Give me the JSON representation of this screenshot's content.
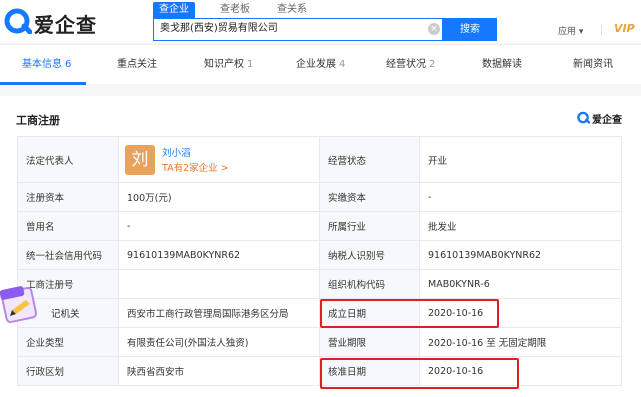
{
  "header": {
    "logo_text": "爱企查",
    "tabs": [
      "查企业",
      "查老板",
      "查关系"
    ],
    "search_value": "奥戈那(西安)贸易有限公司",
    "clear_symbol": "×",
    "search_button": "搜索",
    "apps_label": "应用 ▾",
    "vip_label": "VIP"
  },
  "nav": [
    {
      "label": "基本信息",
      "count": "6"
    },
    {
      "label": "重点关注",
      "count": ""
    },
    {
      "label": "知识产权",
      "count": "1"
    },
    {
      "label": "企业发展",
      "count": "4"
    },
    {
      "label": "经营状况",
      "count": "2"
    },
    {
      "label": "数据解读",
      "count": ""
    },
    {
      "label": "新闻资讯",
      "count": ""
    }
  ],
  "section": {
    "title": "工商注册",
    "brand": "爱企查"
  },
  "table": {
    "legal_rep_label": "法定代表人",
    "legal_rep_avatar": "刘",
    "legal_rep_name": "刘小滔",
    "legal_rep_sub": "TA有2家企业 >",
    "status_label": "经营状态",
    "status_value": "开业",
    "reg_capital_label": "注册资本",
    "reg_capital_value": "100万(元)",
    "paid_capital_label": "实缴资本",
    "paid_capital_value": "-",
    "former_name_label": "曾用名",
    "former_name_value": "-",
    "industry_label": "所属行业",
    "industry_value": "批发业",
    "credit_code_label": "统一社会信用代码",
    "credit_code_value": "91610139MAB0KYNR62",
    "taxpayer_label": "纳税人识别号",
    "taxpayer_value": "91610139MAB0KYNR62",
    "reg_no_label": "工商注册号",
    "reg_no_value": "",
    "org_code_label": "组织机构代码",
    "org_code_value": "MAB0KYNR-6",
    "authority_label": "记机关",
    "authority_value": "西安市工商行政管理局国际港务区分局",
    "founded_label": "成立日期",
    "founded_value": "2020-10-16",
    "company_type_label": "企业类型",
    "company_type_value": "有限责任公司(外国法人独资)",
    "term_label": "营业期限",
    "term_value": "2020-10-16 至 无固定期限",
    "region_label": "行政区划",
    "region_value": "陕西省西安市",
    "approved_label": "核准日期",
    "approved_value": "2020-10-16"
  },
  "colors": {
    "accent": "#1677ff",
    "highlight_box": "#e02020",
    "vip": "#e8a33d"
  }
}
